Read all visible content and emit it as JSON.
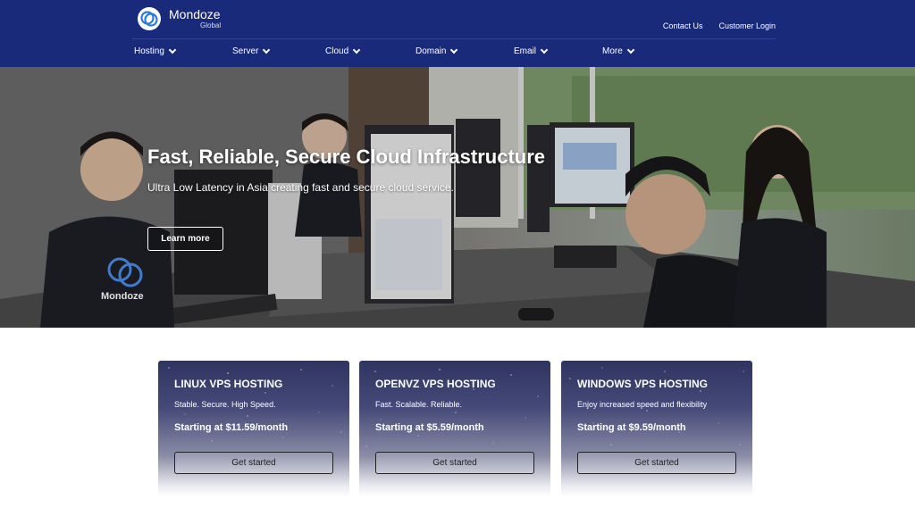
{
  "brand": {
    "name": "Mondoze",
    "sub": "Global",
    "color": "#1a2a7a"
  },
  "top_links": [
    {
      "label": "Contact Us"
    },
    {
      "label": "Customer Login"
    }
  ],
  "nav": [
    {
      "label": "Hosting"
    },
    {
      "label": "Server"
    },
    {
      "label": "Cloud"
    },
    {
      "label": "Domain"
    },
    {
      "label": "Email"
    },
    {
      "label": "More"
    }
  ],
  "hero": {
    "title": "Fast, Reliable, Secure Cloud Infrastructure",
    "subtitle": "Ultra Low Latency in Asia  creating fast and secure cloud service.",
    "button": "Learn more",
    "shirt_text": "Mondoze"
  },
  "cards": [
    {
      "title": "LINUX VPS HOSTING",
      "desc": "Stable. Secure. High Speed.",
      "price": "Starting at $11.59/month",
      "button": "Get started"
    },
    {
      "title": "OPENVZ VPS HOSTING",
      "desc": "Fast. Scalable. Reliable.",
      "price": "Starting at $5.59/month",
      "button": "Get started"
    },
    {
      "title": "WINDOWS VPS HOSTING",
      "desc": "Enjoy increased speed and flexibility",
      "price": "Starting at $9.59/month",
      "button": "Get started"
    }
  ]
}
